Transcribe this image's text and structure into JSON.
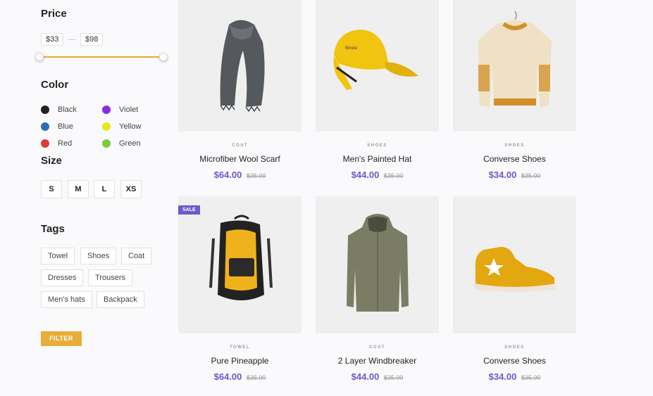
{
  "filters": {
    "price": {
      "title": "Price",
      "min": "$33",
      "max": "$98"
    },
    "color": {
      "title": "Color",
      "items": [
        {
          "label": "Black",
          "color": "#222222"
        },
        {
          "label": "Violet",
          "color": "#8a2be2"
        },
        {
          "label": "Blue",
          "color": "#2a6db5"
        },
        {
          "label": "Yellow",
          "color": "#e8e81a"
        },
        {
          "label": "Red",
          "color": "#dc3b3b"
        },
        {
          "label": "Green",
          "color": "#7ccd3e"
        }
      ]
    },
    "size": {
      "title": "Size",
      "options": [
        "S",
        "M",
        "L",
        "XS"
      ]
    },
    "tags": {
      "title": "Tags",
      "items": [
        "Towel",
        "Shoes",
        "Coat",
        "Dresses",
        "Trousers",
        "Men's hats",
        "Backpack"
      ]
    },
    "filter_button": "FILTER"
  },
  "products": [
    {
      "category": "COAT",
      "name": "Microfiber Wool Scarf",
      "price": "$64.00",
      "old_price": "$35.00",
      "image": "scarf"
    },
    {
      "category": "SHOES",
      "name": "Men's Painted Hat",
      "price": "$44.00",
      "old_price": "$35.00",
      "image": "cap"
    },
    {
      "category": "SHOES",
      "name": "Converse Shoes",
      "price": "$34.00",
      "old_price": "$35.00",
      "image": "sweater"
    },
    {
      "category": "TOWEL",
      "name": "Pure Pineapple",
      "price": "$64.00",
      "old_price": "$35.00",
      "image": "backpack",
      "badge": "SALE"
    },
    {
      "category": "COAT",
      "name": "2 Layer Windbreaker",
      "price": "$44.00",
      "old_price": "$35.00",
      "image": "jacket"
    },
    {
      "category": "SHOES",
      "name": "Converse Shoes",
      "price": "$34.00",
      "old_price": "$35.00",
      "image": "sneaker"
    }
  ]
}
